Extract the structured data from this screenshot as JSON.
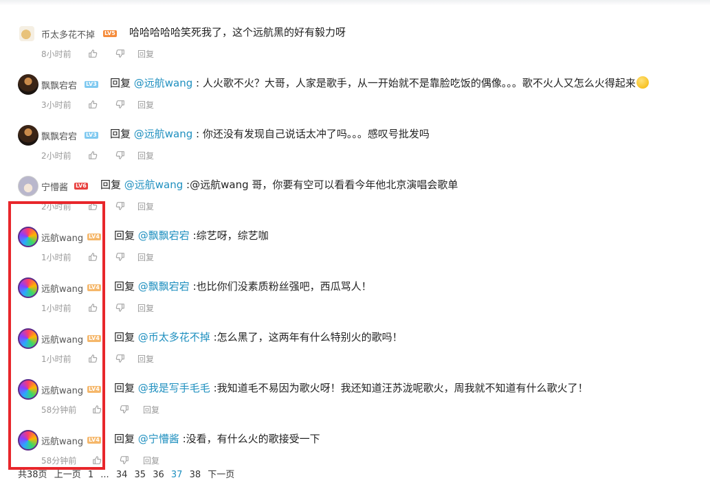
{
  "comments": [
    {
      "user": "币太多花不掉",
      "level": "LV5",
      "level_color": "#f58b3a",
      "avatar": "doge-avatar",
      "prefix": "",
      "mention": "",
      "text": "哈哈哈哈哈笑死我了，这个远航黑的好有毅力呀",
      "time": "8小时前",
      "reply": "回复"
    },
    {
      "user": "飘飘宕宕",
      "level": "LV3",
      "level_color": "#7fc9f0",
      "avatar": "dark-avatar",
      "prefix": "回复 ",
      "mention": "@远航wang",
      "text": " : 人火歌不火？大哥，人家是歌手，从一开始就不是靠脸吃饭的偶像。。。歌不火人又怎么火得起来",
      "emoji": "sweat-emoji",
      "time": "3小时前",
      "reply": "回复"
    },
    {
      "user": "飘飘宕宕",
      "level": "LV3",
      "level_color": "#7fc9f0",
      "avatar": "dark-avatar",
      "prefix": "回复 ",
      "mention": "@远航wang",
      "text": " : 你还没有发现自己说话太冲了吗。。。感叹号批发吗",
      "time": "2小时前",
      "reply": "回复"
    },
    {
      "user": "宁懵酱",
      "level": "LV6",
      "level_color": "#e8413f",
      "avatar": "anime-avatar",
      "prefix": "回复 ",
      "mention": "@远航wang",
      "text": " :@远航wang 哥，你要有空可以看看今年他北京演唱会歌单",
      "time": "2小时前",
      "reply": "回复"
    },
    {
      "user": "远航wang",
      "level": "LV4",
      "level_color": "#f5b76a",
      "avatar": "color-avatar",
      "prefix": "回复 ",
      "mention": "@飘飘宕宕",
      "text": " :综艺呀，综艺咖",
      "time": "1小时前",
      "reply": "回复"
    },
    {
      "user": "远航wang",
      "level": "LV4",
      "level_color": "#f5b76a",
      "avatar": "color-avatar",
      "prefix": "回复 ",
      "mention": "@飘飘宕宕",
      "text": " :也比你们没素质粉丝强吧，西瓜骂人！",
      "time": "1小时前",
      "reply": "回复"
    },
    {
      "user": "远航wang",
      "level": "LV4",
      "level_color": "#f5b76a",
      "avatar": "color-avatar",
      "prefix": "回复 ",
      "mention": "@币太多花不掉",
      "text": " :怎么黑了，这两年有什么特别火的歌吗！",
      "time": "1小时前",
      "reply": "回复"
    },
    {
      "user": "远航wang",
      "level": "LV4",
      "level_color": "#f5b76a",
      "avatar": "color-avatar",
      "prefix": "回复 ",
      "mention": "@我是写手毛毛",
      "text": " :我知道毛不易因为歌火呀！我还知道汪苏泷呢歌火，周我就不知道有什么歌火了！",
      "time": "58分钟前",
      "reply": "回复"
    },
    {
      "user": "远航wang",
      "level": "LV4",
      "level_color": "#f5b76a",
      "avatar": "color-avatar",
      "prefix": "回复 ",
      "mention": "@宁懵酱",
      "text": " :没看，有什么火的歌接受一下",
      "time": "58分钟前",
      "reply": "回复"
    }
  ],
  "pager": {
    "total": "共38页",
    "prev": "上一页",
    "p1": "1",
    "ellipsis": "...",
    "p34": "34",
    "p35": "35",
    "p36": "36",
    "p37": "37",
    "p38": "38",
    "next": "下一页"
  },
  "colors": {
    "mention": "#1e8fbf",
    "highlight": "#e8262b"
  }
}
